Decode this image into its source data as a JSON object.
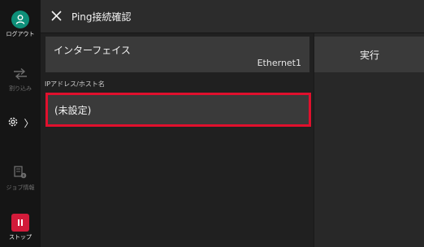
{
  "sidebar": {
    "logout": {
      "label": "ログアウト",
      "icon": "user-icon"
    },
    "scan_in": {
      "label": "割り込み",
      "icon": "interrupt-icon"
    },
    "settings": {
      "icon": "gear-icon",
      "arrow": "〉"
    },
    "job_info": {
      "label": "ジョブ情報",
      "icon": "job-info-icon"
    },
    "stop": {
      "label": "ストップ",
      "icon": "stop-icon"
    }
  },
  "header": {
    "close_icon": "close-icon",
    "title": "Ping接続確認"
  },
  "main": {
    "interface": {
      "label": "インターフェイス",
      "value": "Ethernet1"
    },
    "ip": {
      "label": "IPアドレス/ホスト名",
      "value": "(未設定)"
    },
    "run_label": "実行"
  },
  "colors": {
    "accent_green": "#0e8f79",
    "stop_red": "#d21b3a",
    "highlight_red": "#e0102d"
  }
}
